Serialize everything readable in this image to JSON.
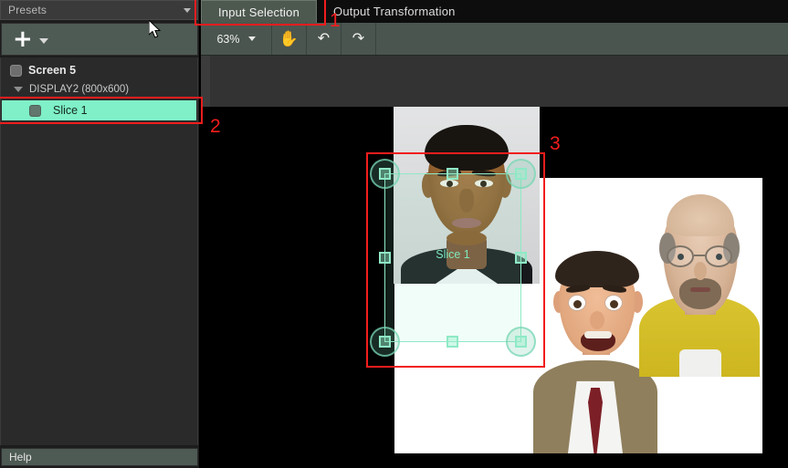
{
  "sidebar": {
    "presets": {
      "label": "Presets",
      "caret_icon": "chevron-down-icon"
    },
    "add_button": {
      "glyph": "+",
      "caret_icon": "chevron-down-icon"
    },
    "tree": {
      "screen": {
        "label": "Screen 5",
        "icon": "node-box-icon"
      },
      "display": {
        "label": "DISPLAY2 (800x600)",
        "icon": "triangle-expanded-icon"
      },
      "slice": {
        "label": "Slice 1",
        "icon": "node-box-icon",
        "selected": true
      }
    },
    "help": {
      "label": "Help"
    }
  },
  "tabs": [
    {
      "label": "Input Selection",
      "active": true
    },
    {
      "label": "Output Transformation",
      "active": false
    }
  ],
  "toolbar": {
    "zoom_value": "63%",
    "zoom_caret_icon": "chevron-down-icon",
    "pan_icon": "hand-icon",
    "undo_icon": "undo-arrow-icon",
    "redo_icon": "redo-arrow-icon",
    "pan_glyph": "✋",
    "undo_glyph": "↶",
    "redo_glyph": "↷"
  },
  "canvas": {
    "slice_overlay_label": "Slice 1",
    "photos": [
      {
        "name": "obama-portrait"
      },
      {
        "name": "mr-bean-portrait"
      },
      {
        "name": "walter-white-portrait"
      }
    ]
  },
  "annotations": [
    {
      "number": "1",
      "target": "input-selection-tab"
    },
    {
      "number": "2",
      "target": "slice-1-tree-item"
    },
    {
      "number": "3",
      "target": "slice-selection-on-canvas"
    }
  ],
  "colors": {
    "accent_teal": "#7ff0c7",
    "annotation_red": "#f21d1d",
    "toolbar_green": "#4a554f",
    "panel_dark": "#2a2a2a",
    "canvas_black": "#000000"
  }
}
